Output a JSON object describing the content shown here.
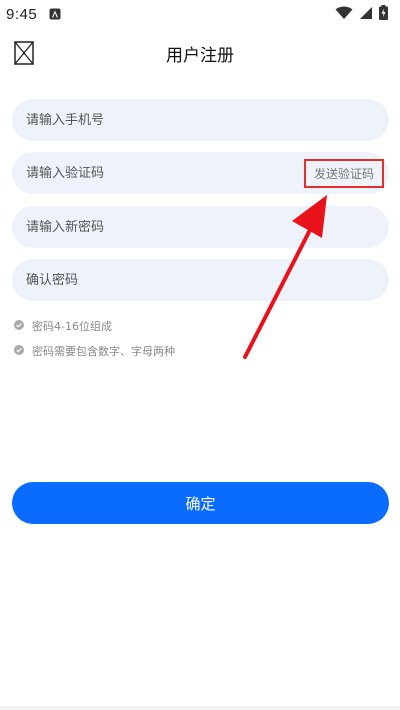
{
  "status_bar": {
    "time": "9:45",
    "icons": [
      "notification-icon",
      "wifi-icon",
      "signal-icon",
      "battery-charging-icon"
    ]
  },
  "header": {
    "title": "用户注册",
    "back_icon": "broken-image-icon"
  },
  "form": {
    "phone_placeholder": "请输入手机号",
    "code_placeholder": "请输入验证码",
    "send_code_label": "发送验证码",
    "new_password_placeholder": "请输入新密码",
    "confirm_password_placeholder": "确认密码"
  },
  "hints": [
    "密码4-16位组成",
    "密码需要包含数字、字母两种"
  ],
  "confirm_label": "确定",
  "colors": {
    "accent": "#0a6cff",
    "field_bg": "#eef3fb",
    "annotation": "#e0302f"
  }
}
